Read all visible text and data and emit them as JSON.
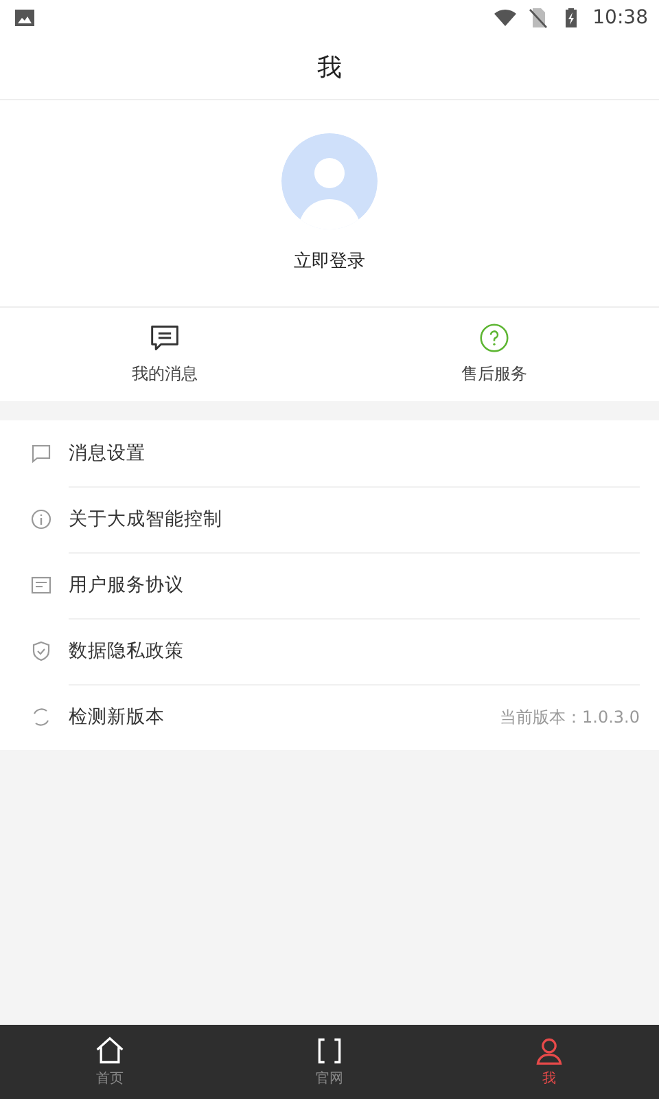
{
  "status_bar": {
    "time": "10:38"
  },
  "title": "我",
  "profile": {
    "login": "立即登录"
  },
  "quick_actions": [
    {
      "kind": "message",
      "label": "我的消息"
    },
    {
      "kind": "help",
      "label": "售后服务"
    }
  ],
  "menu": [
    {
      "kind": "chat",
      "label": "消息设置"
    },
    {
      "kind": "info",
      "label": "关于大成智能控制"
    },
    {
      "kind": "document",
      "label": "用户服务协议"
    },
    {
      "kind": "shield",
      "label": "数据隐私政策"
    },
    {
      "kind": "refresh",
      "label": "检测新版本",
      "value": "当前版本：1.0.3.0"
    }
  ],
  "bottom_nav": [
    {
      "kind": "home",
      "label": "首页",
      "selected": false
    },
    {
      "kind": "web",
      "label": "官网",
      "selected": false
    },
    {
      "kind": "user",
      "label": "我",
      "selected": true
    }
  ]
}
